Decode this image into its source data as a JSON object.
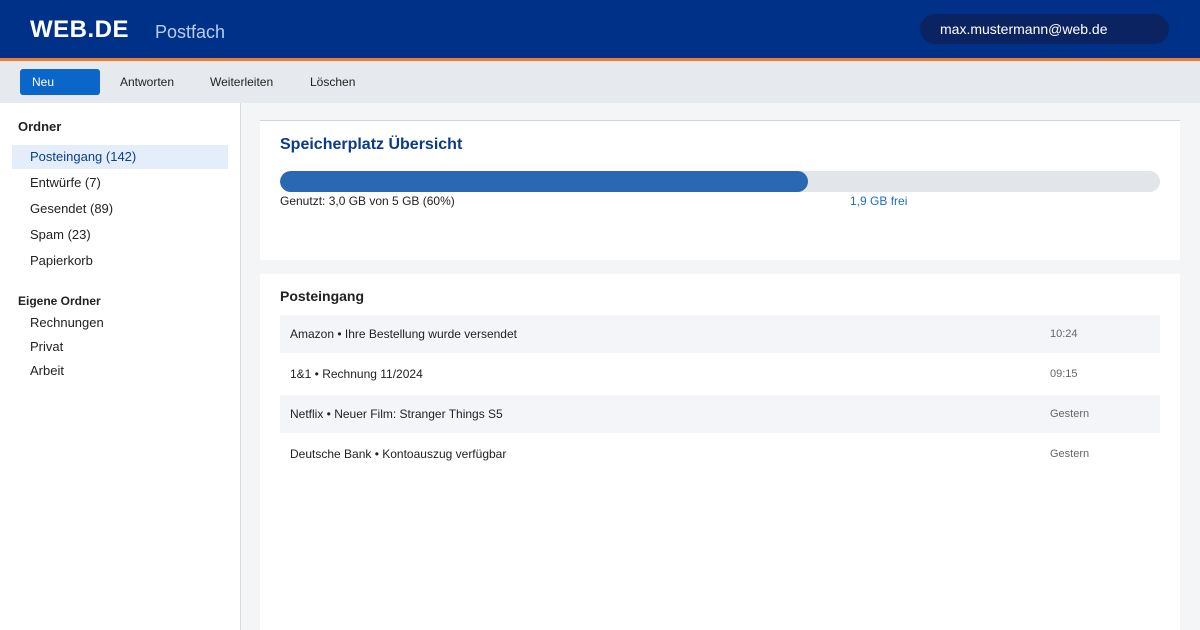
{
  "header": {
    "logo": "WEB.DE",
    "title": "Postfach",
    "user_email": "max.mustermann@web.de"
  },
  "toolbar": {
    "new_label": "Neu",
    "reply_label": "Antworten",
    "forward_label": "Weiterleiten",
    "delete_label": "Löschen"
  },
  "sidebar": {
    "folders_heading": "Ordner",
    "folders": [
      {
        "label": "Posteingang (142)",
        "active": true
      },
      {
        "label": "Entwürfe (7)"
      },
      {
        "label": "Gesendet (89)"
      },
      {
        "label": "Spam (23)"
      },
      {
        "label": "Papierkorb"
      }
    ],
    "custom_heading": "Eigene Ordner",
    "custom_folders": [
      {
        "label": "Rechnungen"
      },
      {
        "label": "Privat"
      },
      {
        "label": "Arbeit"
      }
    ]
  },
  "storage": {
    "title": "Speicherplatz Übersicht",
    "used_fraction": 0.6,
    "used_text": "Genutzt: 3,0 GB von 5 GB (60%)",
    "free_text": "1,9 GB frei"
  },
  "inbox": {
    "title": "Posteingang",
    "messages": [
      {
        "subject": "Amazon • Ihre Bestellung wurde versendet",
        "time": "10:24"
      },
      {
        "subject": "1&1 • Rechnung 11/2024",
        "time": "09:15"
      },
      {
        "subject": "Netflix • Neuer Film: Stranger Things S5",
        "time": "Gestern"
      },
      {
        "subject": "Deutsche Bank • Kontoauszug verfügbar",
        "time": "Gestern"
      }
    ]
  },
  "colors": {
    "header_bg": "#003189",
    "accent_orange": "#f07c28",
    "primary_button": "#0a66c8",
    "progress_fill": "#2a68b3"
  }
}
